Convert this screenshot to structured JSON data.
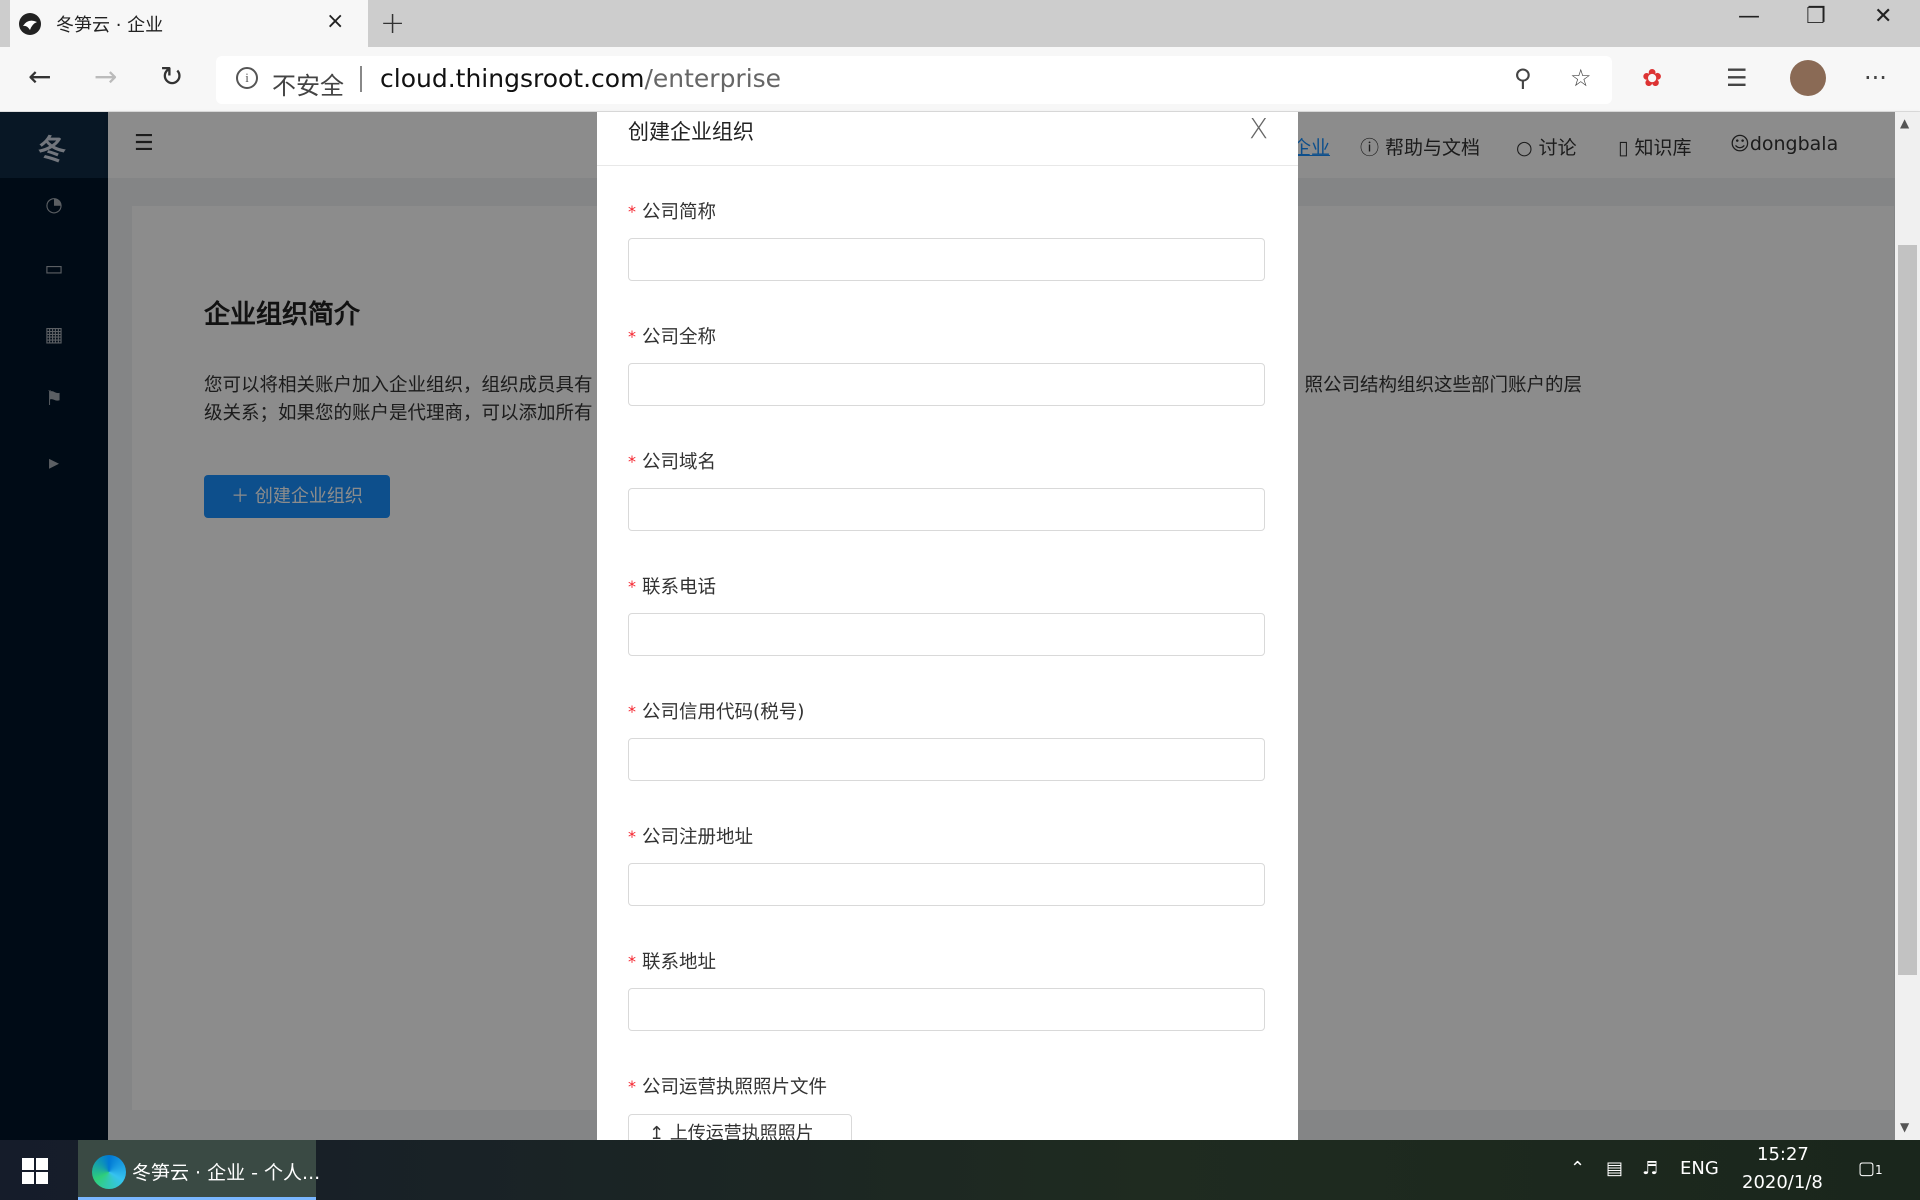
{
  "browser": {
    "tab_title": "冬笋云 · 企业",
    "tab_close": "×",
    "new_tab": "+",
    "insecure_label": "不安全",
    "url_host": "cloud.thingsroot.com",
    "url_path": "/enterprise",
    "more": "···"
  },
  "app": {
    "logo": "冬",
    "header_links": [
      "企业",
      "帮助与文档",
      "讨论",
      "知识库",
      "dongbala"
    ],
    "intro_title": "企业组织简介",
    "intro_line1_left": "您可以将相关账户加入企业组织，组织成员具有",
    "intro_line1_right": "照公司结构组织这些部门账户的层",
    "intro_line2": "级关系；如果您的账户是代理商，可以添加所有",
    "create_button": "创建企业组织"
  },
  "modal": {
    "title": "创建企业组织",
    "close": "X",
    "required_mark": "*",
    "fields": [
      {
        "label": "公司简称",
        "value": ""
      },
      {
        "label": "公司全称",
        "value": ""
      },
      {
        "label": "公司域名",
        "value": ""
      },
      {
        "label": "联系电话",
        "value": ""
      },
      {
        "label": "公司信用代码(税号)",
        "value": ""
      },
      {
        "label": "公司注册地址",
        "value": ""
      },
      {
        "label": "联系地址",
        "value": ""
      }
    ],
    "upload_label": "公司运营执照照片文件",
    "upload_button": "上传运营执照照片"
  },
  "taskbar": {
    "app_label": "冬笋云 · 企业 - 个人...",
    "lang": "ENG",
    "time": "15:27",
    "date": "2020/1/8",
    "notifications": "1"
  }
}
